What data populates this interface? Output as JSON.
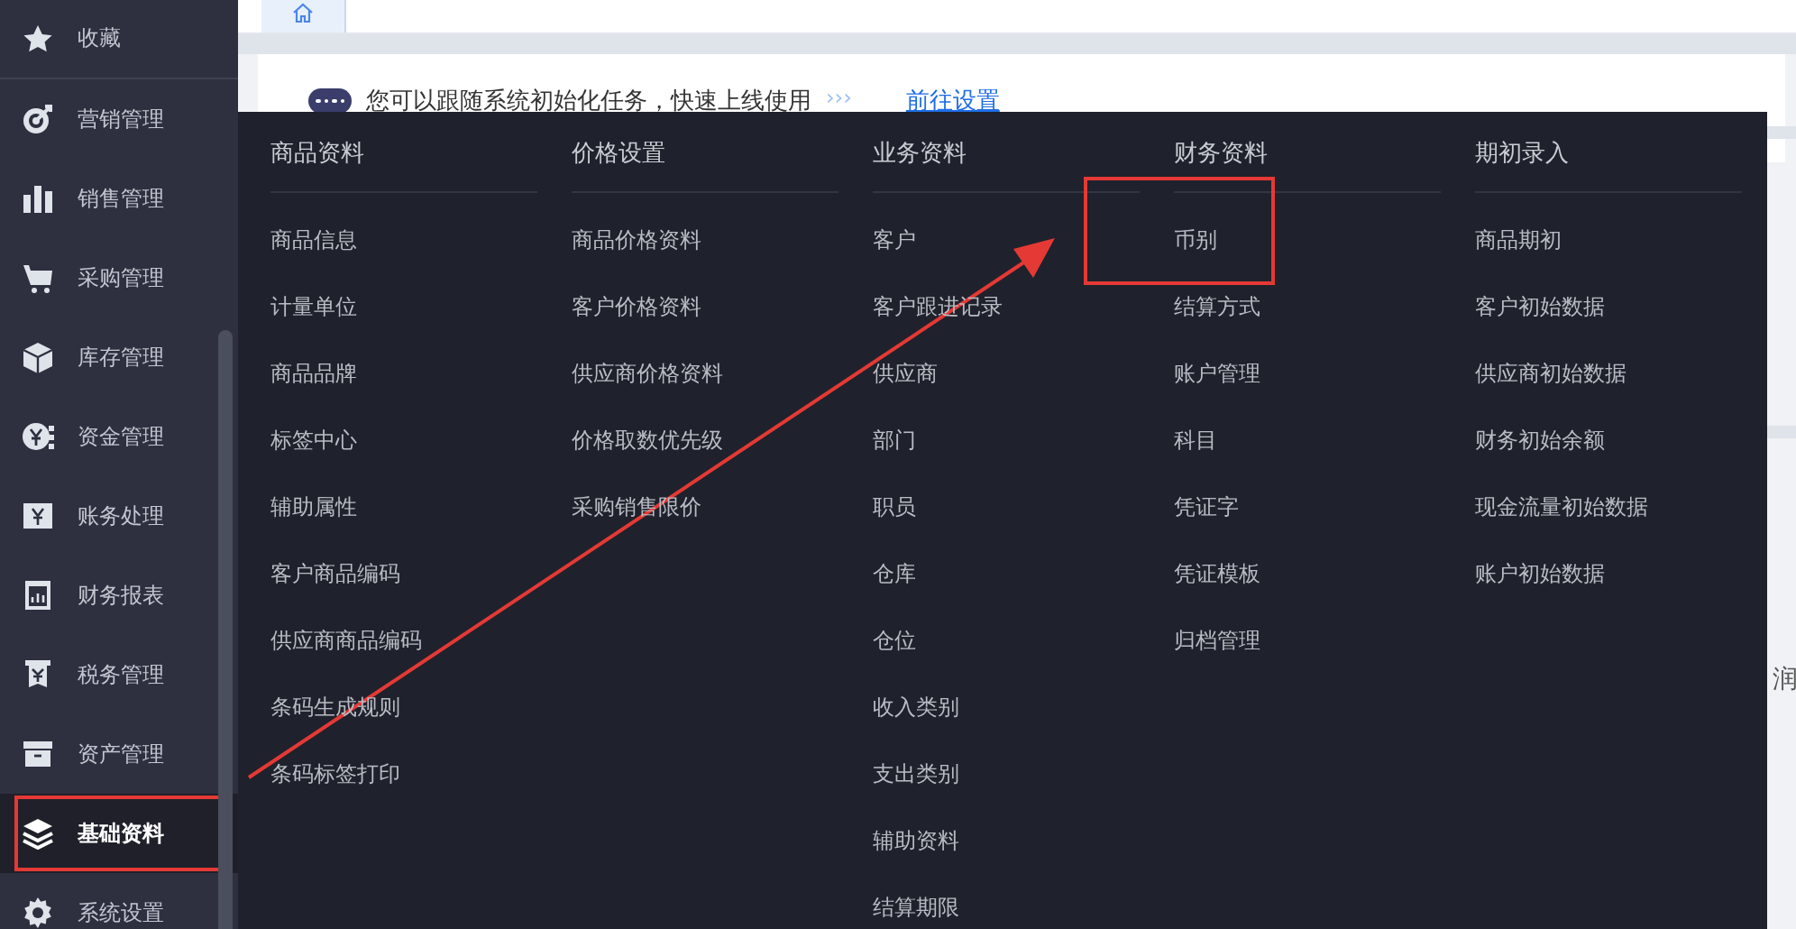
{
  "sidebar": {
    "items": [
      {
        "label": "收藏",
        "selected": false,
        "highlighted": false
      },
      {
        "label": "营销管理",
        "selected": false,
        "highlighted": false
      },
      {
        "label": "销售管理",
        "selected": false,
        "highlighted": false
      },
      {
        "label": "采购管理",
        "selected": false,
        "highlighted": false
      },
      {
        "label": "库存管理",
        "selected": false,
        "highlighted": false
      },
      {
        "label": "资金管理",
        "selected": false,
        "highlighted": false
      },
      {
        "label": "账务处理",
        "selected": false,
        "highlighted": false
      },
      {
        "label": "财务报表",
        "selected": false,
        "highlighted": false
      },
      {
        "label": "税务管理",
        "selected": false,
        "highlighted": false
      },
      {
        "label": "资产管理",
        "selected": false,
        "highlighted": false
      },
      {
        "label": "基础资料",
        "selected": true,
        "highlighted": true
      },
      {
        "label": "系统设置",
        "selected": false,
        "highlighted": false
      }
    ]
  },
  "notice": {
    "text": "您可以跟随系统初始化任务，快速上线使用",
    "dots": "›››",
    "link": "前往设置"
  },
  "menu": {
    "columns": [
      {
        "title": "商品资料",
        "items": [
          {
            "label": "商品信息",
            "highlighted": false
          },
          {
            "label": "计量单位",
            "highlighted": false
          },
          {
            "label": "商品品牌",
            "highlighted": false
          },
          {
            "label": "标签中心",
            "highlighted": false
          },
          {
            "label": "辅助属性",
            "highlighted": false
          },
          {
            "label": "客户商品编码",
            "highlighted": false
          },
          {
            "label": "供应商商品编码",
            "highlighted": false
          },
          {
            "label": "条码生成规则",
            "highlighted": false
          },
          {
            "label": "条码标签打印",
            "highlighted": false
          }
        ]
      },
      {
        "title": "价格设置",
        "items": [
          {
            "label": "商品价格资料",
            "highlighted": false
          },
          {
            "label": "客户价格资料",
            "highlighted": false
          },
          {
            "label": "供应商价格资料",
            "highlighted": false
          },
          {
            "label": "价格取数优先级",
            "highlighted": false
          },
          {
            "label": "采购销售限价",
            "highlighted": false
          }
        ]
      },
      {
        "title": "业务资料",
        "items": [
          {
            "label": "客户",
            "highlighted": false
          },
          {
            "label": "客户跟进记录",
            "highlighted": false
          },
          {
            "label": "供应商",
            "highlighted": false
          },
          {
            "label": "部门",
            "highlighted": false
          },
          {
            "label": "职员",
            "highlighted": false
          },
          {
            "label": "仓库",
            "highlighted": false
          },
          {
            "label": "仓位",
            "highlighted": false
          },
          {
            "label": "收入类别",
            "highlighted": false
          },
          {
            "label": "支出类别",
            "highlighted": false
          },
          {
            "label": "辅助资料",
            "highlighted": false
          },
          {
            "label": "结算期限",
            "highlighted": false
          }
        ]
      },
      {
        "title": "财务资料",
        "items": [
          {
            "label": "币别",
            "highlighted": true
          },
          {
            "label": "结算方式",
            "highlighted": false
          },
          {
            "label": "账户管理",
            "highlighted": false
          },
          {
            "label": "科目",
            "highlighted": false
          },
          {
            "label": "凭证字",
            "highlighted": false
          },
          {
            "label": "凭证模板",
            "highlighted": false
          },
          {
            "label": "归档管理",
            "highlighted": false
          }
        ]
      },
      {
        "title": "期初录入",
        "items": [
          {
            "label": "商品期初",
            "highlighted": false
          },
          {
            "label": "客户初始数据",
            "highlighted": false
          },
          {
            "label": "供应商初始数据",
            "highlighted": false
          },
          {
            "label": "财务初始余额",
            "highlighted": false
          },
          {
            "label": "现金流量初始数据",
            "highlighted": false
          },
          {
            "label": "账户初始数据",
            "highlighted": false
          }
        ]
      }
    ]
  },
  "right_edge_text": "润"
}
